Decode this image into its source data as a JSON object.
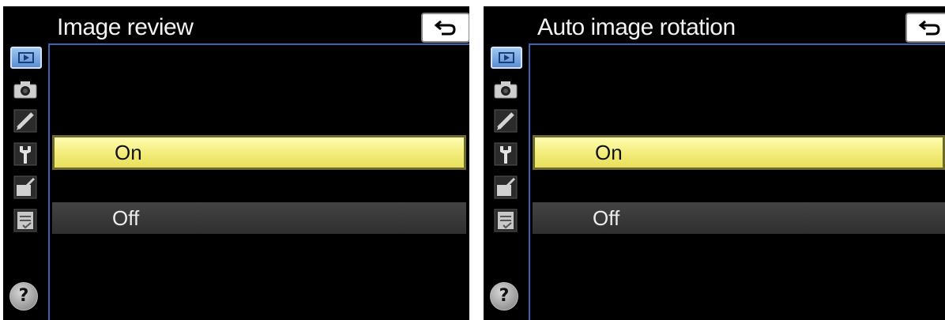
{
  "panels": [
    {
      "title": "Image review",
      "options": [
        {
          "label": "On",
          "selected": true
        },
        {
          "label": "Off",
          "selected": false
        }
      ],
      "help_label": "?"
    },
    {
      "title": "Auto image rotation",
      "options": [
        {
          "label": "On",
          "selected": true
        },
        {
          "label": "Off",
          "selected": false
        }
      ],
      "help_label": "?"
    }
  ],
  "menu_tabs": [
    {
      "icon": "playback-icon",
      "active": true
    },
    {
      "icon": "camera-icon",
      "active": false
    },
    {
      "icon": "pencil-icon",
      "active": false
    },
    {
      "icon": "wrench-icon",
      "active": false
    },
    {
      "icon": "retouch-icon",
      "active": false
    },
    {
      "icon": "my-menu-icon",
      "active": false
    }
  ],
  "colors": {
    "background": "#000000",
    "highlight": "#f2ec78",
    "frame": "#3d62b8",
    "active_tab": "#7aa9e3"
  }
}
